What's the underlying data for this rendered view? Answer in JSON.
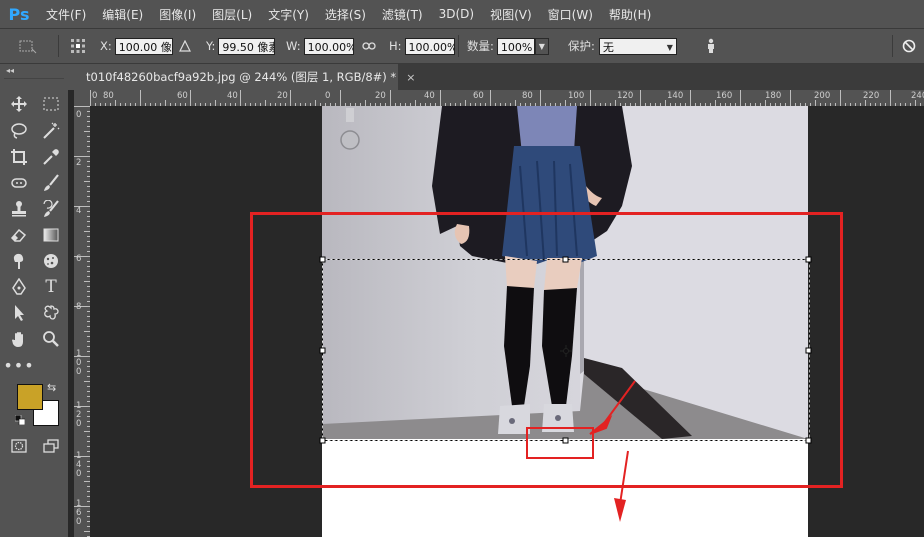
{
  "app": {
    "logo": "Ps"
  },
  "menu": [
    "文件(F)",
    "编辑(E)",
    "图像(I)",
    "图层(L)",
    "文字(Y)",
    "选择(S)",
    "滤镜(T)",
    "3D(D)",
    "视图(V)",
    "窗口(W)",
    "帮助(H)"
  ],
  "options": {
    "x_label": "X:",
    "x_value": "100.00 像素",
    "y_label": "Y:",
    "y_value": "99.50 像素",
    "w_label": "W:",
    "w_value": "100.00%",
    "h_label": "H:",
    "h_value": "100.00%",
    "qty_label": "数量:",
    "qty_value": "100%",
    "protect_label": "保护:",
    "protect_value": "无"
  },
  "document": {
    "tab_title": "t010f48260bacf9a92b.jpg @ 244% (图层 1, RGB/8#) *",
    "close": "×"
  },
  "rulers": {
    "horizontal": [
      "0",
      "80",
      "60",
      "40",
      "20",
      "0",
      "20",
      "40",
      "60",
      "80",
      "100",
      "120",
      "140",
      "160",
      "180",
      "200",
      "220",
      "240"
    ],
    "vertical": [
      "0",
      "2",
      "4",
      "6",
      "8",
      "1 0 0",
      "1 2 0",
      "1 4 0",
      "1 6 0"
    ]
  },
  "colors": {
    "foreground": "#c9a227",
    "background": "#ffffff",
    "annotation": "#e53935",
    "accent": "#31a8ff"
  },
  "tools": [
    "move-tool-icon",
    "marquee-tool-icon",
    "lasso-tool-icon",
    "magic-wand-tool-icon",
    "crop-tool-icon",
    "eyedropper-tool-icon",
    "healing-brush-tool-icon",
    "brush-tool-icon",
    "stamp-tool-icon",
    "history-brush-tool-icon",
    "eraser-tool-icon",
    "gradient-tool-icon",
    "smudge-tool-icon",
    "sponge-tool-icon",
    "pen-tool-icon",
    "type-tool-icon",
    "path-selection-tool-icon",
    "custom-shape-tool-icon",
    "hand-tool-icon",
    "zoom-tool-icon",
    "more-tools-icon",
    "quick-mask-icon",
    "screen-mode-icon"
  ]
}
